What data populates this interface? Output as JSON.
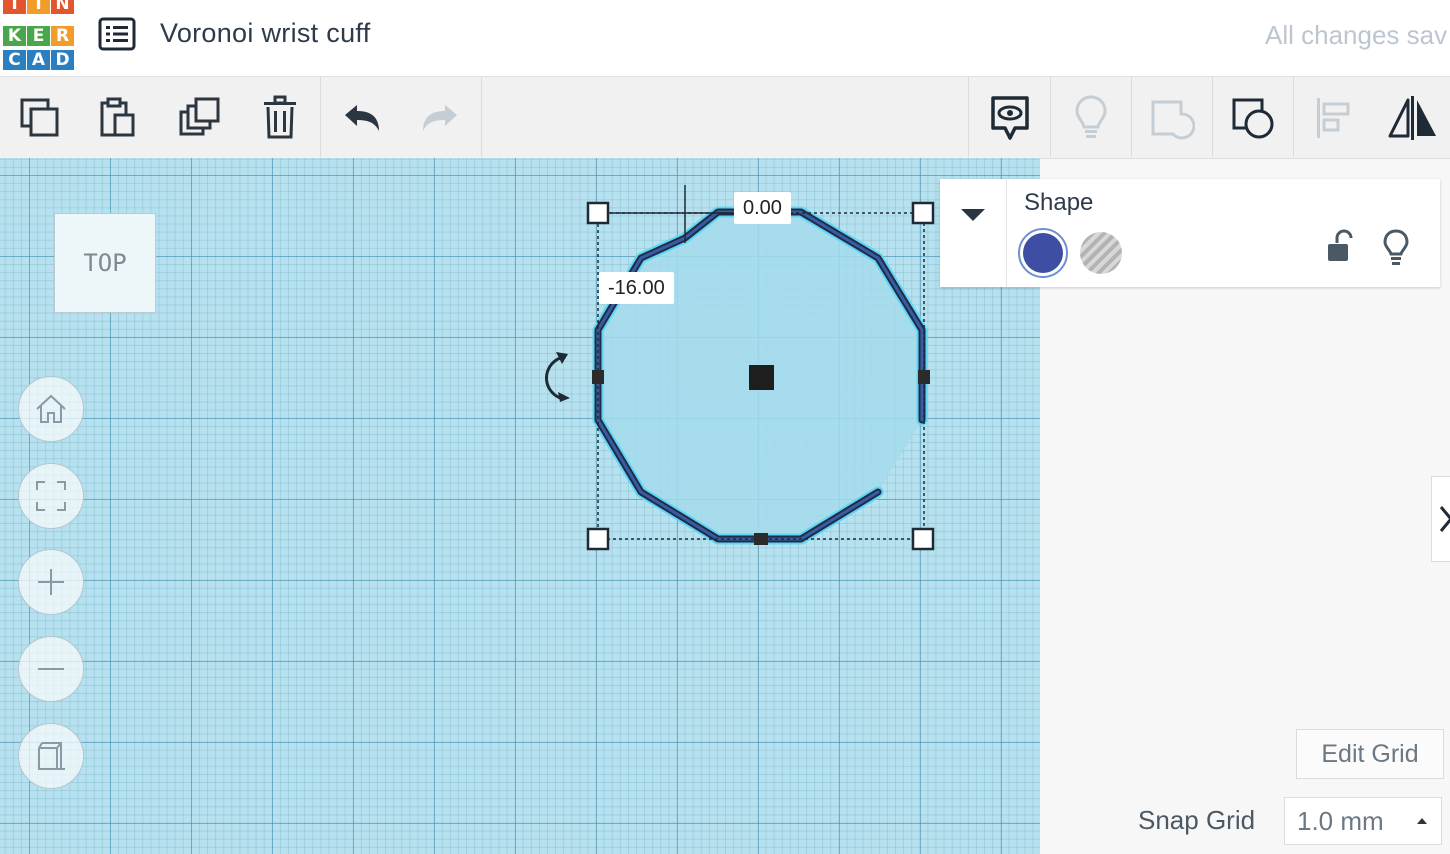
{
  "app": {
    "logo_letters": [
      "T",
      "I",
      "N",
      "K",
      "E",
      "R",
      "C",
      "A",
      "D"
    ],
    "logo_colors": {
      "top": "#e2552d",
      "middle": "#4aa64a",
      "bottom": "#2a7fc1",
      "orange": "#f29d2a"
    },
    "project_title": "Voronoi wrist cuff",
    "save_status": "All changes sav"
  },
  "toolbar": {
    "left_tools": [
      "copy-icon",
      "paste-icon",
      "duplicate-icon",
      "trash-icon",
      "undo-icon",
      "redo-icon"
    ],
    "right_tools": [
      "note-icon",
      "lightbulb-icon",
      "group-icon",
      "ungroup-icon",
      "align-icon",
      "mirror-icon"
    ]
  },
  "canvas": {
    "view_cube_label": "TOP",
    "nav_buttons": [
      "home-icon",
      "fit-view-icon",
      "zoom-in-icon",
      "zoom-out-icon",
      "perspective-icon"
    ],
    "dimensions": {
      "x_offset": "0.00",
      "y_offset": "-16.00"
    },
    "grid_color": "#b7e1ee",
    "shape_color": "#3a4f9c"
  },
  "inspector": {
    "title": "Shape",
    "solid_color": "#3d4ea3",
    "hole_label_icon": "hole-swatch-icon"
  },
  "grid_controls": {
    "edit_grid_label": "Edit Grid",
    "snap_grid_label": "Snap Grid",
    "snap_grid_value": "1.0 mm"
  }
}
